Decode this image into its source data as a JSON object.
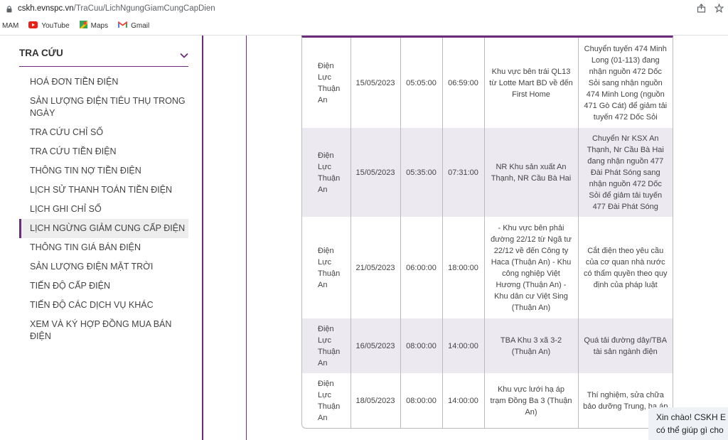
{
  "browser": {
    "url_host": "cskh.evnspc.vn",
    "url_path": "/TraCuu/LichNgungGiamCungCapDien",
    "bookmarks": [
      {
        "label": "MAM",
        "icon": "none"
      },
      {
        "label": "YouTube",
        "icon": "youtube-icon"
      },
      {
        "label": "Maps",
        "icon": "maps-icon"
      },
      {
        "label": "Gmail",
        "icon": "gmail-icon"
      }
    ]
  },
  "sidebar": {
    "title": "TRA CỨU",
    "items": [
      {
        "label": "Hoá đơn tiền điện"
      },
      {
        "label": "Sản lượng điện tiêu thụ trong ngày"
      },
      {
        "label": "Tra cứu chỉ số"
      },
      {
        "label": "Tra cứu tiền điện"
      },
      {
        "label": "Thông tin nợ tiền điện"
      },
      {
        "label": "Lịch sử thanh toán tiền điện"
      },
      {
        "label": "Lịch ghi chỉ số"
      },
      {
        "label": "Lịch ngừng giảm cung cấp điện",
        "active": true
      },
      {
        "label": "Thông tin giá bán điện"
      },
      {
        "label": "Sản lượng điện mặt trời"
      },
      {
        "label": "Tiến độ cấp điện"
      },
      {
        "label": "Tiến độ các dịch vụ khác"
      },
      {
        "label": "Xem và ký hợp đồng mua bán điện"
      }
    ]
  },
  "table": {
    "rows": [
      {
        "unit": "Điện Lực Thuận An",
        "date": "15/05/2023",
        "start": "05:05:00",
        "end": "06:59:00",
        "area": "Khu vực bên trái QL13 từ Lotte Mart BD về đến First Home",
        "reason": "Chuyển tuyến 474 Minh Long (01-113) đang nhận nguồn 472 Dốc Sỏi sang nhận nguồn 474 Minh Long (nguồn 471 Gò Cát) để giảm tải tuyến 472 Dốc Sỏi"
      },
      {
        "unit": "Điện Lực Thuận An",
        "date": "15/05/2023",
        "start": "05:35:00",
        "end": "07:31:00",
        "area": "NR Khu sản xuất An Thạnh, NR Cầu Bà Hai",
        "reason": "Chuyển Nr KSX An Thạnh, Nr Cầu Bà Hai đang nhận nguồn 477 Đài Phát Sóng sang nhận nguồn 472 Dốc Sỏi để giảm tải tuyến 477 Đài Phát Sóng"
      },
      {
        "unit": "Điện Lực Thuận An",
        "date": "21/05/2023",
        "start": "06:00:00",
        "end": "18:00:00",
        "area": "- Khu vực bên phải đường 22/12 từ Ngã tư 22/12 về đến Công ty Haca (Thuận An) - Khu công nghiệp Việt Hương (Thuận An) - Khu dân cư Việt Sing (Thuận An)",
        "reason": "Cắt điện theo yêu cầu của cơ quan nhà nước có thẩm quyền theo quy định của pháp luật"
      },
      {
        "unit": "Điện Lực Thuận An",
        "date": "16/05/2023",
        "start": "08:00:00",
        "end": "14:00:00",
        "area": "TBA Khu 3 xã 3-2 (Thuận An)",
        "reason": "Quá tải đường dây/TBA tài sản ngành điện"
      },
      {
        "unit": "Điện Lực Thuận An",
        "date": "18/05/2023",
        "start": "08:00:00",
        "end": "14:00:00",
        "area": "Khu vực lưới hạ áp trạm Đồng Ba 3 (Thuận An)",
        "reason": "Thí nghiệm, sửa chữa bảo dưỡng Trung, hạ áp"
      }
    ]
  },
  "chat": {
    "line1": "Xin chào! CSKH E",
    "line2": "có thể giúp gì cho"
  }
}
